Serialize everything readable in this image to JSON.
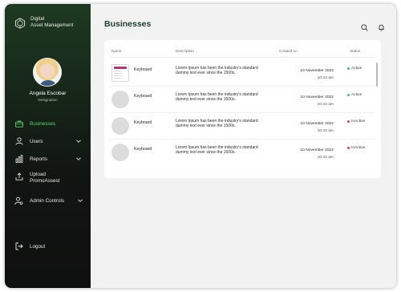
{
  "brand": {
    "name_line1": "Digital",
    "name_line2": "Asset Management"
  },
  "profile": {
    "name": "Angela Escobar",
    "role": "Designation"
  },
  "sidebar": {
    "items": [
      {
        "label": "Businesses",
        "icon": "briefcase-icon",
        "active": true
      },
      {
        "label": "Users",
        "icon": "user-icon",
        "has_chevron": true
      },
      {
        "label": "Reports",
        "icon": "bar-chart-icon",
        "has_chevron": true
      },
      {
        "label": "Upload PromoAssest",
        "icon": "upload-icon"
      },
      {
        "label": "Admin Controls",
        "icon": "admin-gear-icon",
        "has_chevron": true
      }
    ],
    "logout_label": "Logout"
  },
  "page": {
    "title": "Businesses"
  },
  "table": {
    "columns": {
      "name": "Name",
      "description": "Description",
      "created_on": "Created on",
      "status": "Status"
    },
    "rows": [
      {
        "name": "Keyboard",
        "description": "Lorem Ipsum has been the industry's standard dummy text ever since the 1500s.",
        "date": "10 November 2022",
        "time": "10:43 am",
        "status": "Active",
        "thumb": "image"
      },
      {
        "name": "Keyboard",
        "description": "Lorem Ipsum has been the industry's standard dummy text ever since the 1500s.",
        "date": "10 November 2022",
        "time": "10:43 am",
        "status": "Active",
        "thumb": "placeholder"
      },
      {
        "name": "Keyboard",
        "description": "Lorem Ipsum has been the industry's standard dummy text ever since the 1500s.",
        "date": "10 November 2022",
        "time": "10:43 am",
        "status": "InActive",
        "thumb": "placeholder"
      },
      {
        "name": "Keyboard",
        "description": "Lorem Ipsum has been the industry's standard dummy text ever since the 1500s.",
        "date": "10 November 2022",
        "time": "10:43 am",
        "status": "InActive",
        "thumb": "placeholder"
      }
    ]
  },
  "colors": {
    "active_accent": "#5fd36b",
    "status_active": "#3fbf6a",
    "status_inactive": "#e0413a",
    "title": "#1d3b2b"
  }
}
